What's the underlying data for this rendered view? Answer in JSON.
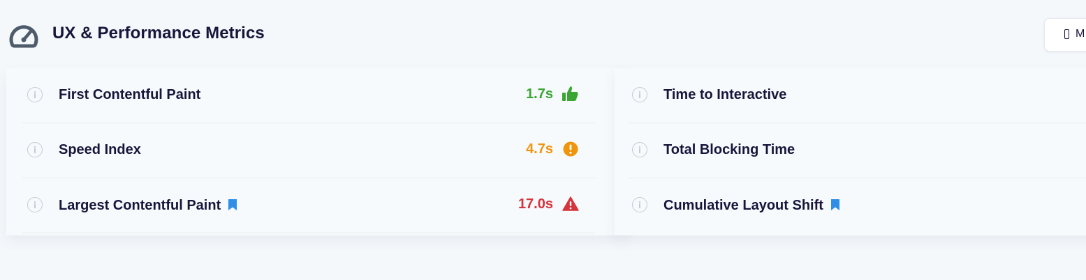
{
  "header": {
    "title": "UX & Performance Metrics",
    "icon": "speedometer-icon",
    "device_toggle_label": "M"
  },
  "colors": {
    "good": "#3aa532",
    "average": "#f0940c",
    "poor": "#d6333c",
    "bookmark": "#2f8fe8",
    "title": "#17153a"
  },
  "metrics_left": [
    {
      "label": "First Contentful Paint",
      "value": "1.7s",
      "status": "good",
      "status_icon": "thumbs-up-icon",
      "bookmarked": false
    },
    {
      "label": "Speed Index",
      "value": "4.7s",
      "status": "average",
      "status_icon": "exclamation-circle-icon",
      "bookmarked": false
    },
    {
      "label": "Largest Contentful Paint",
      "value": "17.0s",
      "status": "poor",
      "status_icon": "warning-triangle-icon",
      "bookmarked": true
    }
  ],
  "metrics_right": [
    {
      "label": "Time to Interactive",
      "bookmarked": false
    },
    {
      "label": "Total Blocking Time",
      "bookmarked": false
    },
    {
      "label": "Cumulative Layout Shift",
      "bookmarked": true
    }
  ]
}
